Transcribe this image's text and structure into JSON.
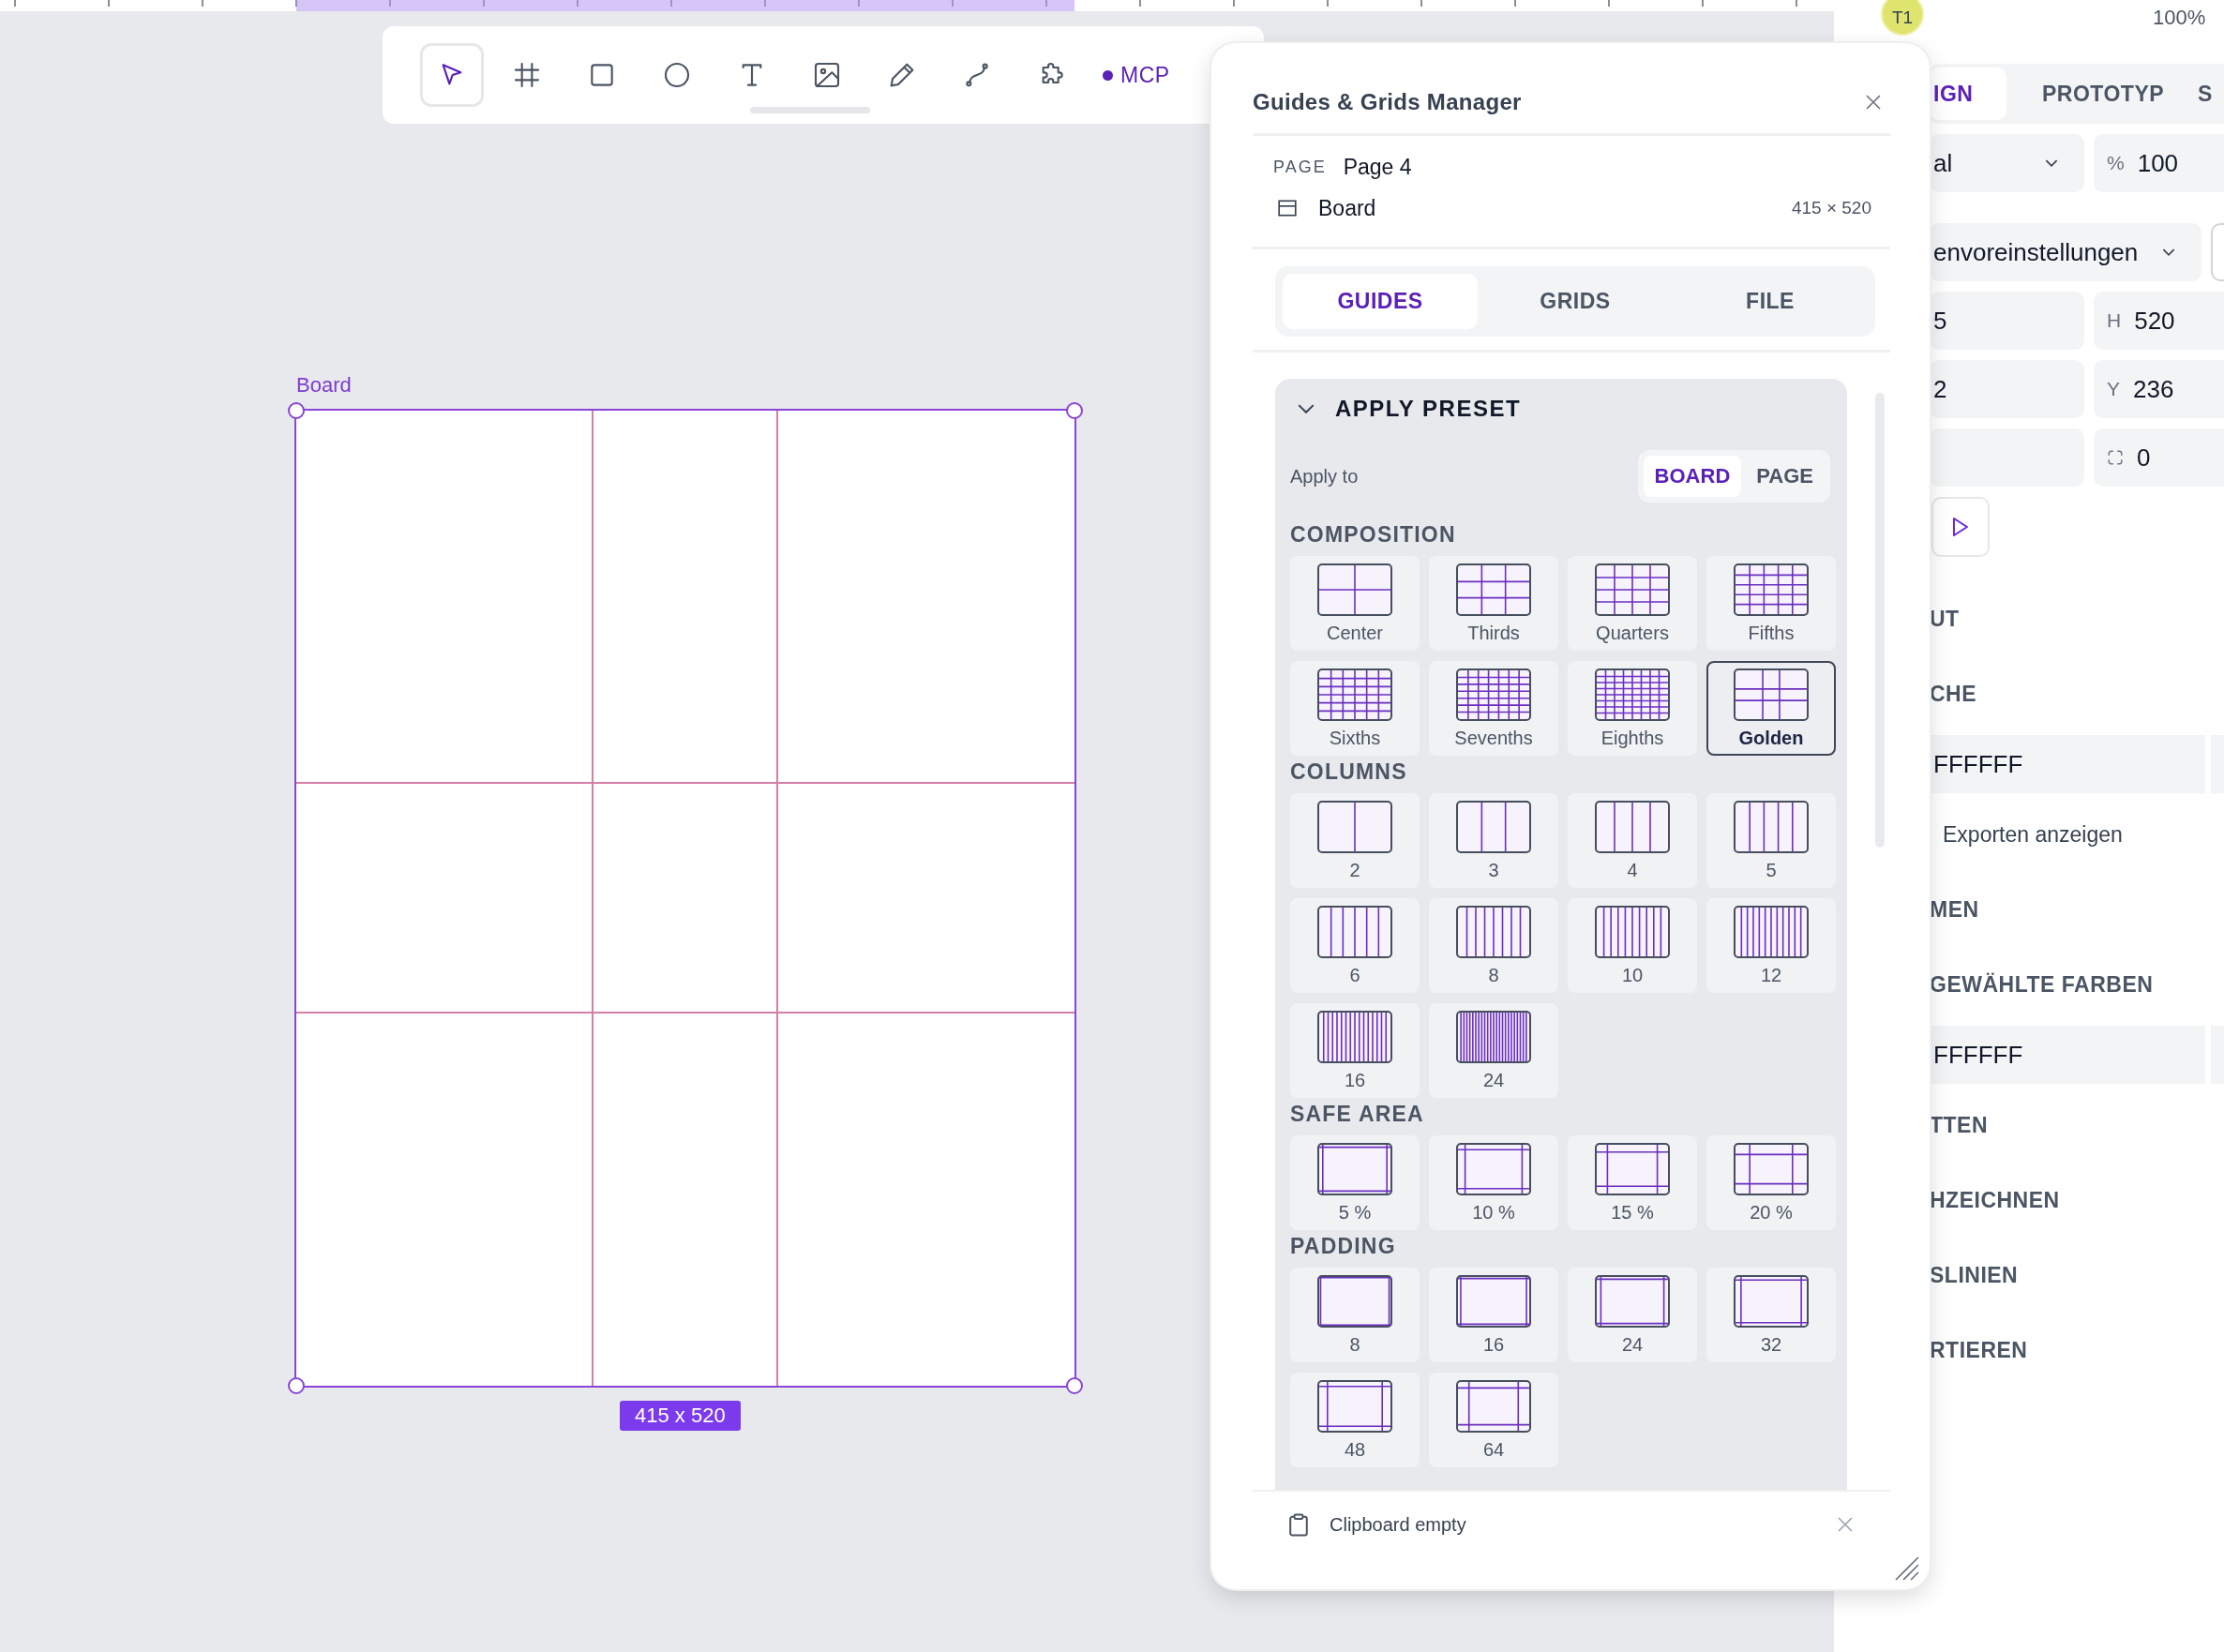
{
  "toolbar": {
    "tools": [
      {
        "kind": "select",
        "selected": true
      },
      {
        "kind": "frame",
        "selected": false
      },
      {
        "kind": "rectangle",
        "selected": false
      },
      {
        "kind": "ellipse",
        "selected": false
      },
      {
        "kind": "text",
        "selected": false
      },
      {
        "kind": "image",
        "selected": false
      },
      {
        "kind": "pen",
        "selected": false
      },
      {
        "kind": "path",
        "selected": false
      },
      {
        "kind": "plugin",
        "selected": false
      }
    ],
    "mcp": {
      "label": "MCP",
      "connected": true
    }
  },
  "board": {
    "name": "Board",
    "size": "415 x 520"
  },
  "dialog": {
    "title": "Guides & Grids Manager",
    "page_label": "PAGE",
    "page_name": "Page 4",
    "board_name": "Board",
    "board_size": "415 × 520",
    "tabs": [
      {
        "label": "GUIDES",
        "selected": true
      },
      {
        "label": "GRIDS",
        "selected": false
      },
      {
        "label": "FILE",
        "selected": false
      }
    ],
    "presets": {
      "title": "APPLY PRESET",
      "expanded": true,
      "apply_to_label": "Apply to",
      "targets": [
        {
          "label": "BOARD",
          "selected": true
        },
        {
          "label": "PAGE",
          "selected": false
        }
      ],
      "groups": [
        {
          "kind": "composition",
          "title": "COMPOSITION",
          "items": [
            {
              "label": "Center",
              "selected": false
            },
            {
              "label": "Thirds",
              "selected": false
            },
            {
              "label": "Quarters",
              "selected": false
            },
            {
              "label": "Fifths",
              "selected": false
            },
            {
              "label": "Sixths",
              "selected": false
            },
            {
              "label": "Sevenths",
              "selected": false
            },
            {
              "label": "Eighths",
              "selected": false
            },
            {
              "label": "Golden",
              "selected": true
            }
          ]
        },
        {
          "kind": "columns",
          "title": "COLUMNS",
          "items": [
            {
              "label": "2",
              "selected": false
            },
            {
              "label": "3",
              "selected": false
            },
            {
              "label": "4",
              "selected": false
            },
            {
              "label": "5",
              "selected": false
            },
            {
              "label": "6",
              "selected": false
            },
            {
              "label": "8",
              "selected": false
            },
            {
              "label": "10",
              "selected": false
            },
            {
              "label": "12",
              "selected": false
            },
            {
              "label": "16",
              "selected": false
            },
            {
              "label": "24",
              "selected": false
            }
          ]
        },
        {
          "kind": "safe_area",
          "title": "SAFE AREA",
          "items": [
            {
              "label": "5 %",
              "selected": false
            },
            {
              "label": "10 %",
              "selected": false
            },
            {
              "label": "15 %",
              "selected": false
            },
            {
              "label": "20 %",
              "selected": false
            }
          ]
        },
        {
          "kind": "padding",
          "title": "PADDING",
          "items": [
            {
              "label": "8",
              "selected": false
            },
            {
              "label": "16",
              "selected": false
            },
            {
              "label": "24",
              "selected": false
            },
            {
              "label": "32",
              "selected": false
            },
            {
              "label": "48",
              "selected": false
            },
            {
              "label": "64",
              "selected": false
            }
          ]
        }
      ]
    },
    "clipboard": "Clipboard empty"
  },
  "inspector": {
    "avatar": "T1",
    "zoom": "100%",
    "tabs": [
      {
        "label": "IGN",
        "selected": true
      },
      {
        "label": "PROTOTYP",
        "selected": false
      },
      {
        "label": "S",
        "selected": false
      }
    ],
    "rows": [
      [
        {
          "kind": "select",
          "value": "al"
        },
        {
          "kind": "field",
          "prefix": "%",
          "value": "100"
        }
      ],
      [
        {
          "kind": "select",
          "value": "envoreinstellungen"
        },
        {
          "kind": "toggle"
        }
      ],
      [
        {
          "kind": "field",
          "value": "5"
        },
        {
          "kind": "field",
          "prefix": "H",
          "value": "520"
        }
      ],
      [
        {
          "kind": "field",
          "value": "2"
        },
        {
          "kind": "field",
          "prefix": "Y",
          "value": "236"
        }
      ],
      [
        {
          "kind": "field"
        },
        {
          "kind": "radius",
          "value": "0"
        }
      ],
      [
        {
          "kind": "play"
        }
      ]
    ],
    "sections": [
      {
        "kind": "header",
        "text": "UT"
      },
      {
        "kind": "header",
        "text": "CHE"
      },
      {
        "kind": "color",
        "text": "FFFFFF"
      },
      {
        "kind": "text",
        "text": "Exporten anzeigen"
      },
      {
        "kind": "header",
        "text": "MEN"
      },
      {
        "kind": "header",
        "text": "GEWÄHLTE FARBEN"
      },
      {
        "kind": "color",
        "text": "FFFFFF"
      },
      {
        "kind": "header",
        "text": "TTEN"
      },
      {
        "kind": "header",
        "text": "HZEICHNEN"
      },
      {
        "kind": "header",
        "text": "SLINIEN"
      },
      {
        "kind": "header",
        "text": "RTIEREN"
      }
    ]
  }
}
